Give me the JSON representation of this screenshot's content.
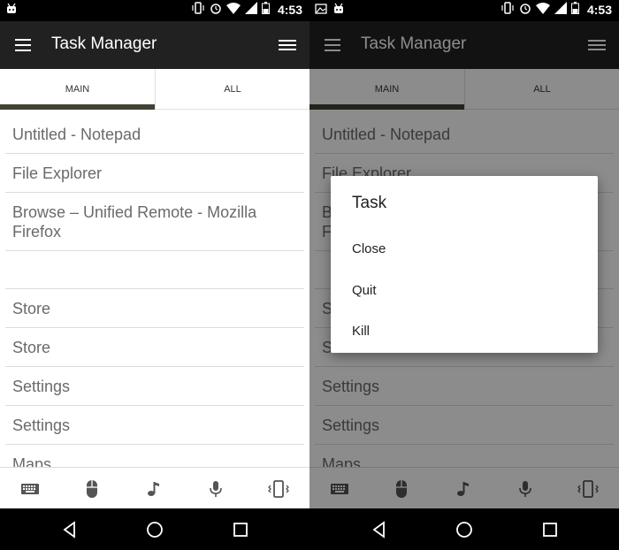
{
  "status": {
    "time": "4:53"
  },
  "app": {
    "title": "Task Manager"
  },
  "tabs": [
    {
      "label": "MAIN"
    },
    {
      "label": "ALL"
    }
  ],
  "list": {
    "items": [
      {
        "label": "Untitled - Notepad"
      },
      {
        "label": "File Explorer"
      },
      {
        "label": "Browse – Unified Remote - Mozilla Firefox"
      },
      {
        "label": ""
      },
      {
        "label": "Store"
      },
      {
        "label": "Store"
      },
      {
        "label": "Settings"
      },
      {
        "label": "Settings"
      },
      {
        "label": "Maps"
      }
    ]
  },
  "toolbar": {
    "icons": [
      "keyboard-icon",
      "mouse-icon",
      "music-note-icon",
      "microphone-icon",
      "vibrate-phone-icon"
    ]
  },
  "dialog": {
    "title": "Task",
    "options": [
      {
        "label": "Close"
      },
      {
        "label": "Quit"
      },
      {
        "label": "Kill"
      }
    ]
  },
  "colors": {
    "appbar": "#212121",
    "tab_indicator": "#424134",
    "list_text": "#6a6a6a"
  }
}
